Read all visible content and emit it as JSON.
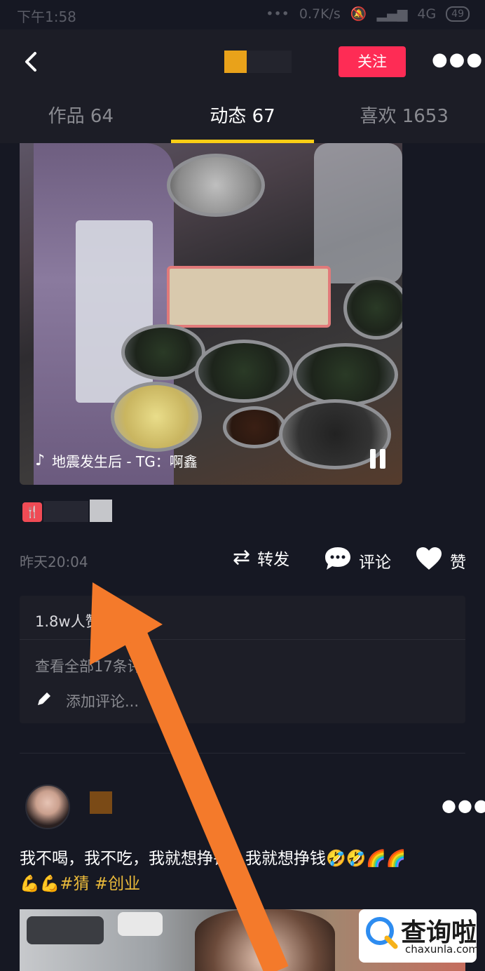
{
  "status_bar": {
    "time": "下午1:58",
    "dots": "•••",
    "speed": "0.7K/s",
    "network": "4G",
    "battery": "49"
  },
  "header": {
    "back_icon": "chevron-left-icon",
    "follow_label": "关注",
    "more_icon": "more-horizontal-icon",
    "tabs": [
      {
        "label": "作品 64",
        "active": false
      },
      {
        "label": "动态 67",
        "active": true
      },
      {
        "label": "喜欢 1653",
        "active": false
      }
    ],
    "accent_color": "#face15",
    "follow_color": "#fe2c55"
  },
  "post1": {
    "video_caption": "地震发生后 - TG：啊鑫",
    "timestamp": "昨天20:04",
    "actions": [
      {
        "icon": "repost-icon",
        "label": "转发"
      },
      {
        "icon": "comment-icon",
        "label": "评论"
      },
      {
        "icon": "heart-icon",
        "label": "赞"
      }
    ],
    "likes_text": "1.8w人赞",
    "view_all_comments": "查看全部17条评论",
    "add_comment_placeholder": "添加评论..."
  },
  "post2": {
    "text": "我不喝，我不吃，我就想挣钱，我就想挣钱🤣🤣🌈🌈",
    "emoji_line": "💪💪",
    "hashtags": [
      "#猜",
      "#创业"
    ]
  },
  "watermark": {
    "main": "查询啦",
    "sub": "chaxunla.com"
  },
  "overlay_arrow_color": "#f47a2b"
}
